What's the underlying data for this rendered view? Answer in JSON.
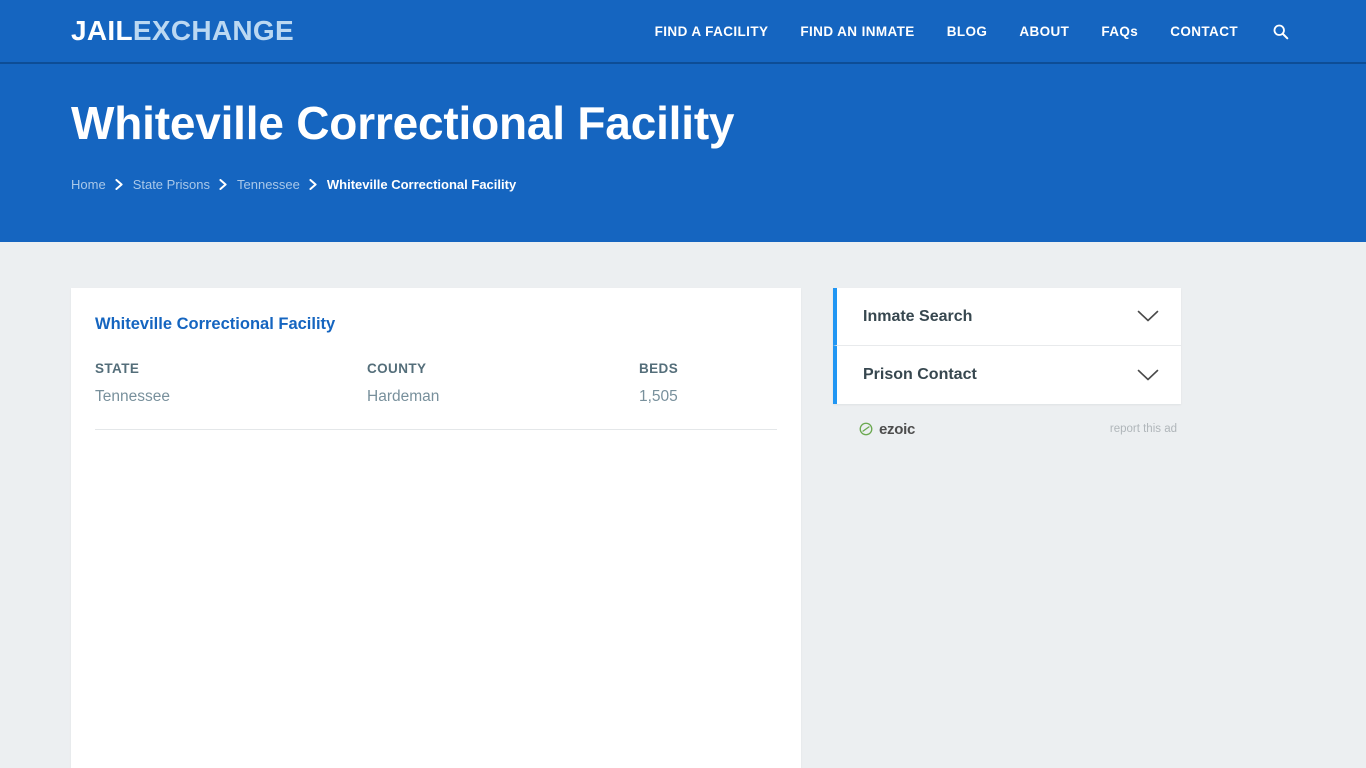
{
  "site": {
    "logo_primary": "JAIL",
    "logo_secondary": "EXCHANGE"
  },
  "nav": {
    "items": [
      {
        "label": "FIND A FACILITY"
      },
      {
        "label": "FIND AN INMATE"
      },
      {
        "label": "BLOG"
      },
      {
        "label": "ABOUT"
      },
      {
        "label": "FAQs"
      },
      {
        "label": "CONTACT"
      }
    ],
    "search_icon": "search-icon"
  },
  "hero": {
    "title": "Whiteville Correctional Facility",
    "breadcrumb": [
      {
        "label": "Home",
        "current": false
      },
      {
        "label": "State Prisons",
        "current": false
      },
      {
        "label": "Tennessee",
        "current": false
      },
      {
        "label": "Whiteville Correctional Facility",
        "current": true
      }
    ]
  },
  "facility": {
    "title": "Whiteville Correctional Facility",
    "facts": [
      {
        "label": "STATE",
        "value": "Tennessee"
      },
      {
        "label": "COUNTY",
        "value": "Hardeman"
      },
      {
        "label": "BEDS",
        "value": "1,505"
      }
    ]
  },
  "sidebar": {
    "accordions": [
      {
        "label": "Inmate Search",
        "icon": "chevron-down-icon"
      },
      {
        "label": "Prison Contact",
        "icon": "chevron-down-icon"
      }
    ],
    "ad": {
      "brand": "ezoic",
      "report_label": "report this ad"
    }
  },
  "colors": {
    "brand_blue": "#1565c0",
    "accent_blue": "#2196f3",
    "page_bg": "#eceff1",
    "heading_blue": "#1565c0",
    "ezoic_green": "#6aa84f"
  }
}
